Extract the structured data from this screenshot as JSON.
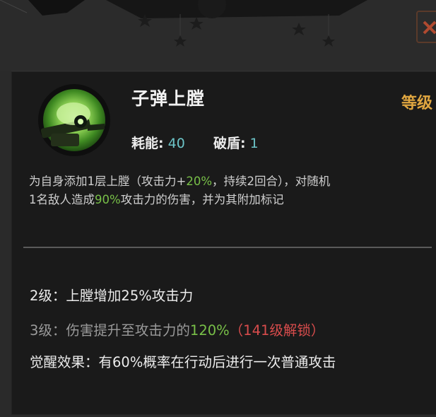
{
  "skill": {
    "name": "子弹上膛",
    "level_label": "等级",
    "icon": "gunner-aiming-icon",
    "energy_label": "耗能:",
    "energy_value": "40",
    "shield_break_label": "破盾:",
    "shield_break_value": "1",
    "description": {
      "p1": "为自身添加1层上膛（攻击力+",
      "atk_bonus": "20%",
      "p2": "，持续2回合），对随机",
      "p3": "1名敌人造成",
      "damage_pct": "90%",
      "p4": "攻击力的伤害，并为其附加标记"
    },
    "upgrades": {
      "level2": "2级：上膛增加25%攻击力",
      "level3_prefix": "3级：伤害提升至攻击力的",
      "level3_value": "120%",
      "level3_lock": "（141级解锁）"
    },
    "awaken": "觉醒效果：有60%概率在行动后进行一次普通攻击"
  },
  "colors": {
    "panel_bg": "#1a1a1a",
    "highlight_green": "#78c048",
    "stat_value": "#6cc4c8",
    "level_tag": "#e0a640",
    "locked_red": "#d84c4c",
    "locked_text": "#9a9a9a"
  }
}
